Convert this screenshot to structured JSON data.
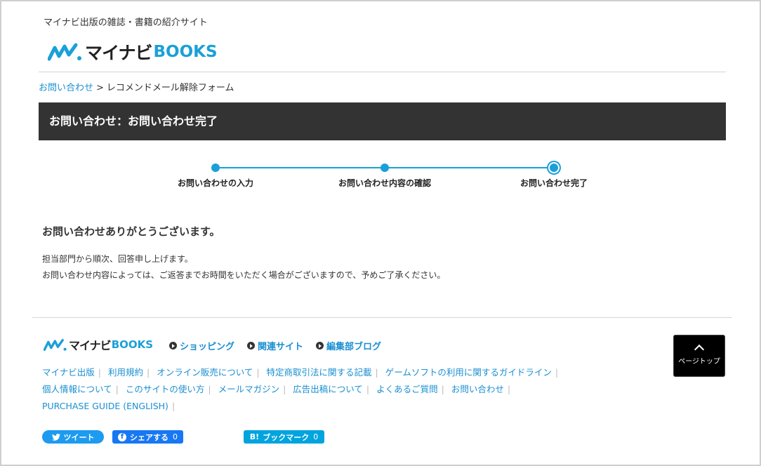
{
  "header": {
    "tagline": "マイナビ出版の雑誌・書籍の紹介サイト",
    "logo_jp": "マイナビ",
    "logo_en": "BOOKS"
  },
  "breadcrumb": {
    "link": "お問い合わせ",
    "sep": ">",
    "current": "レコメンドメール解除フォーム"
  },
  "page_title": "お問い合わせ：お問い合わせ完了",
  "steps": [
    {
      "label": "お問い合わせの入力"
    },
    {
      "label": "お問い合わせ内容の確認"
    },
    {
      "label": "お問い合わせ完了"
    }
  ],
  "content": {
    "thanks": "お問い合わせありがとうございます。",
    "line1": "担当部門から順次、回答申し上げます。",
    "line2": "お問い合わせ内容によっては、ご返答までお時間をいただく場合がございますので、予めご了承ください。"
  },
  "footer": {
    "logo_jp": "マイナビ",
    "logo_en": "BOOKS",
    "nav": [
      "ショッピング",
      "関連サイト",
      "編集部ブログ"
    ],
    "links_row1": [
      "マイナビ出版",
      "利用規約",
      "オンライン販売について",
      "特定商取引法に関する記載",
      "ゲームソフトの利用に関するガイドライン"
    ],
    "links_row2": [
      "個人情報について",
      "このサイトの使い方",
      "メールマガジン",
      "広告出稿について",
      "よくあるご質問",
      "お問い合わせ"
    ],
    "links_row3": [
      "PURCHASE GUIDE (ENGLISH)"
    ],
    "pagetop": "ページトップ"
  },
  "social": {
    "tweet": "ツイート",
    "fb_share": "シェアする",
    "fb_count": "0",
    "hatena": "ブックマーク",
    "hatena_icon": "B!",
    "hatena_count": "0"
  }
}
